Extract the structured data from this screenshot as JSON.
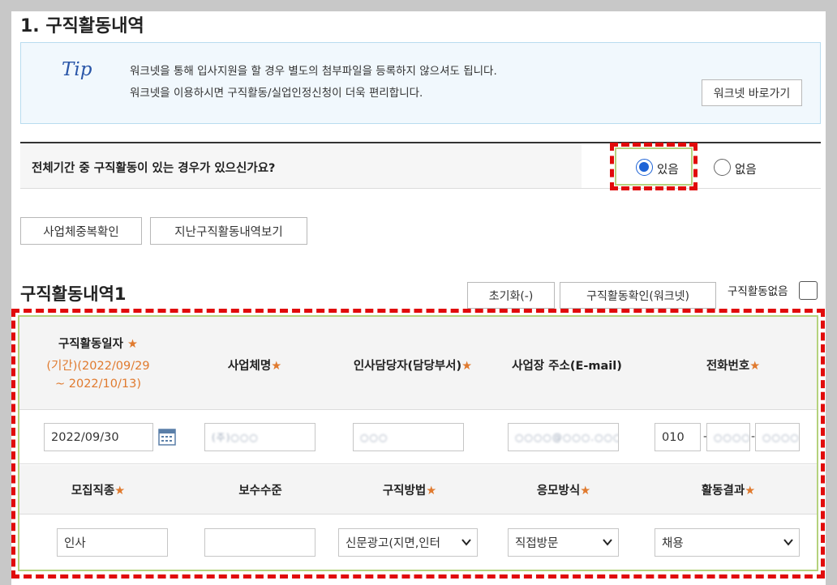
{
  "section": {
    "title": "1. 구직활동내역"
  },
  "tip": {
    "label": "Tip",
    "line1": "워크넷을 통해 입사지원을 할 경우 별도의 첨부파일을 등록하지 않으셔도 됩니다.",
    "line2": "워크넷을 이용하시면 구직활동/실업인정신청이 더욱 편리합니다.",
    "button": "워크넷 바로가기"
  },
  "question": {
    "text": "전체기간 중 구직활동이 있는 경우가 있으신가요?",
    "options": [
      {
        "label": "있음",
        "selected": true
      },
      {
        "label": "없음",
        "selected": false
      }
    ]
  },
  "actions": {
    "duplicate_check": "사업체중복확인",
    "past_history": "지난구직활동내역보기"
  },
  "record": {
    "title": "구직활동내역1",
    "reset": "초기화(-)",
    "verify": "구직활동확인(워크넷)",
    "no_activity": "구직활동없음",
    "star": "★",
    "headers1": {
      "date": "구직활동일자",
      "period_line1": "(기간)(2022/09/29",
      "period_line2": "~ 2022/10/13)",
      "company": "사업체명",
      "manager": "인사담당자(담당부서)",
      "address": "사업장 주소(E-mail)",
      "phone": "전화번호"
    },
    "values1": {
      "date": "2022/09/30",
      "company": "(주)○○○",
      "manager": "○○○",
      "address": "○○○○@○○○.○○○",
      "phone1": "010",
      "phone2": "○○○○",
      "phone3": "○○○○"
    },
    "headers2": {
      "job": "모집직종",
      "salary": "보수수준",
      "method": "구직방법",
      "apply": "응모방식",
      "result": "활동결과"
    },
    "values2": {
      "job": "인사",
      "salary": "",
      "method": "신문광고(지면,인터",
      "apply": "직접방문",
      "result": "채용"
    }
  },
  "colors": {
    "highlight_red": "#e10b0b",
    "highlight_green": "#b5d27d",
    "radio_blue": "#1e63d6",
    "star_orange": "#e07a2e"
  }
}
